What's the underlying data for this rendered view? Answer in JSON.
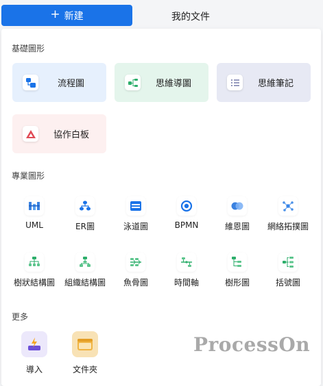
{
  "topbar": {
    "new_label": "新建",
    "tab_label": "我的文件"
  },
  "basic": {
    "title": "基礎圖形",
    "cards": [
      {
        "label": "流程圖",
        "bg": "#e6f0fd",
        "accent": "#1a73e8",
        "icon": "flowchart-icon"
      },
      {
        "label": "思維導圖",
        "bg": "#e4f5ec",
        "accent": "#2dae6b",
        "icon": "mindmap-icon"
      },
      {
        "label": "思維筆記",
        "bg": "#e7e9f4",
        "accent": "#6b72a6",
        "icon": "notes-icon"
      },
      {
        "label": "協作白板",
        "bg": "#fdf0f0",
        "accent": "#e04a55",
        "icon": "whiteboard-icon"
      }
    ]
  },
  "pro": {
    "title": "專業圖形",
    "tools": [
      {
        "label": "UML",
        "icon": "uml-icon"
      },
      {
        "label": "ER圖",
        "icon": "er-icon"
      },
      {
        "label": "泳道圖",
        "icon": "swimlane-icon"
      },
      {
        "label": "BPMN",
        "icon": "bpmn-icon"
      },
      {
        "label": "維恩圖",
        "icon": "venn-icon"
      },
      {
        "label": "網絡拓撲圖",
        "icon": "network-icon"
      },
      {
        "label": "樹狀結構圖",
        "icon": "tree-structure-icon"
      },
      {
        "label": "組織結構圖",
        "icon": "org-chart-icon"
      },
      {
        "label": "魚骨圖",
        "icon": "fishbone-icon"
      },
      {
        "label": "時間軸",
        "icon": "timeline-icon"
      },
      {
        "label": "樹形圖",
        "icon": "tree-icon"
      },
      {
        "label": "括號圖",
        "icon": "bracket-icon"
      }
    ]
  },
  "more": {
    "title": "更多",
    "items": [
      {
        "label": "導入",
        "bg": "#ece8fb",
        "accent": "#6b4fd8",
        "icon": "import-icon"
      },
      {
        "label": "文件夾",
        "bg": "#f8e2b5",
        "accent": "#f0b443",
        "icon": "folder-icon"
      }
    ]
  },
  "watermark": "ProcessOn"
}
